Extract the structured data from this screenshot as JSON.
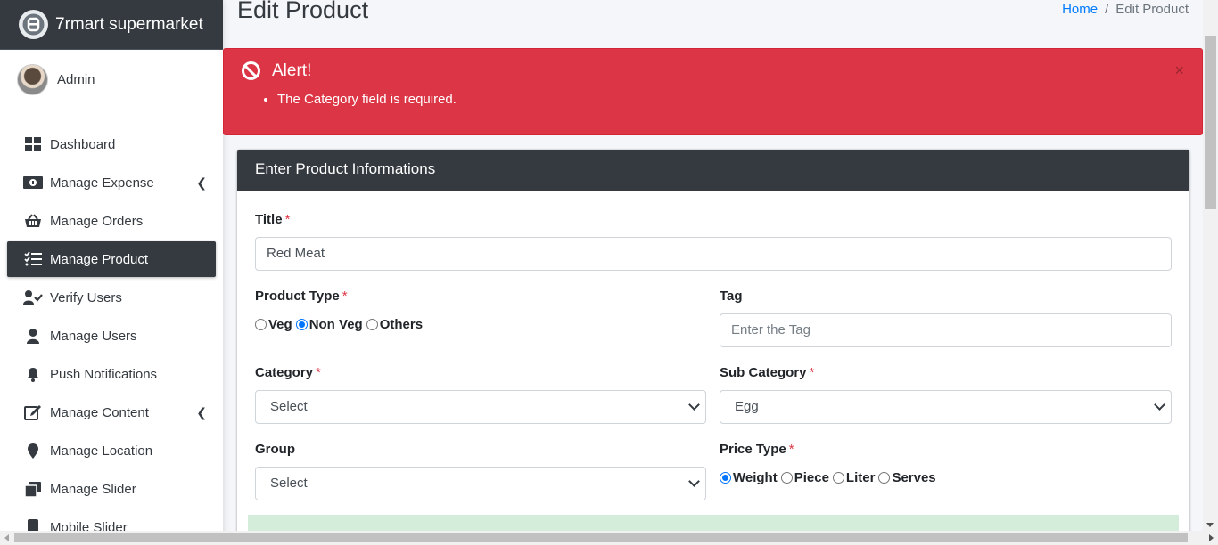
{
  "brand": {
    "name": "7rmart supermarket",
    "logo_icon": "logo-icon"
  },
  "user": {
    "name": "Admin"
  },
  "sidebar": {
    "items": [
      {
        "label": "Dashboard",
        "icon": "dashboard-icon",
        "glyph": "▦",
        "active": false,
        "has_submenu": false
      },
      {
        "label": "Manage Expense",
        "icon": "money-icon",
        "glyph": "▣",
        "active": false,
        "has_submenu": true
      },
      {
        "label": "Manage Orders",
        "icon": "basket-icon",
        "glyph": "⌂",
        "active": false,
        "has_submenu": false
      },
      {
        "label": "Manage Product",
        "icon": "tasks-icon",
        "glyph": "☰",
        "active": true,
        "has_submenu": false
      },
      {
        "label": "Verify Users",
        "icon": "user-check-icon",
        "glyph": "✔",
        "active": false,
        "has_submenu": false
      },
      {
        "label": "Manage Users",
        "icon": "user-icon",
        "glyph": "●",
        "active": false,
        "has_submenu": false
      },
      {
        "label": "Push Notifications",
        "icon": "bell-icon",
        "glyph": "◆",
        "active": false,
        "has_submenu": false
      },
      {
        "label": "Manage Content",
        "icon": "edit-icon",
        "glyph": "✎",
        "active": false,
        "has_submenu": true
      },
      {
        "label": "Manage Location",
        "icon": "map-marker-icon",
        "glyph": "●",
        "active": false,
        "has_submenu": false
      },
      {
        "label": "Manage Slider",
        "icon": "clone-icon",
        "glyph": "❐",
        "active": false,
        "has_submenu": false
      },
      {
        "label": "Mobile Slider",
        "icon": "mobile-icon",
        "glyph": "▯",
        "active": false,
        "has_submenu": false
      }
    ]
  },
  "header": {
    "title": "Edit Product",
    "breadcrumb": {
      "home": "Home",
      "separator": "/",
      "current": "Edit Product"
    }
  },
  "alert": {
    "title": "Alert!",
    "messages": [
      "The Category field is required."
    ],
    "close": "×",
    "color": "#dc3545"
  },
  "form": {
    "header": "Enter Product Informations",
    "title": {
      "label": "Title",
      "required": "*",
      "value": "Red Meat"
    },
    "product_type": {
      "label": "Product Type",
      "required": "*",
      "options": [
        "Veg",
        "Non Veg",
        "Others"
      ],
      "selected": "Non Veg"
    },
    "tag": {
      "label": "Tag",
      "placeholder": "Enter the Tag"
    },
    "category": {
      "label": "Category",
      "required": "*",
      "value": "Select"
    },
    "sub_category": {
      "label": "Sub Category",
      "required": "*",
      "value": "Egg"
    },
    "group": {
      "label": "Group",
      "value": "Select"
    },
    "price_type": {
      "label": "Price Type",
      "required": "*",
      "options": [
        "Weight",
        "Piece",
        "Liter",
        "Serves"
      ],
      "selected": "Weight"
    }
  },
  "colors": {
    "dark": "#343a40",
    "danger": "#dc3545",
    "primary": "#007bff",
    "radio": "#0075ff"
  }
}
